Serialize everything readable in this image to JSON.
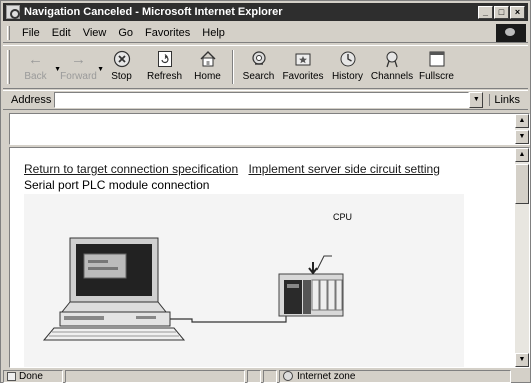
{
  "window": {
    "title": "Navigation Canceled - Microsoft Internet Explorer",
    "controls": [
      "minimize",
      "maximize",
      "close"
    ]
  },
  "menu": {
    "items": [
      {
        "label": "File"
      },
      {
        "label": "Edit"
      },
      {
        "label": "View"
      },
      {
        "label": "Go"
      },
      {
        "label": "Favorites"
      },
      {
        "label": "Help"
      }
    ]
  },
  "toolbar": {
    "back": {
      "label": "Back",
      "icon": "back-arrow-icon",
      "enabled": false
    },
    "forward": {
      "label": "Forward",
      "icon": "forward-arrow-icon",
      "enabled": false
    },
    "stop": {
      "label": "Stop",
      "icon": "stop-icon"
    },
    "refresh": {
      "label": "Refresh",
      "icon": "refresh-icon"
    },
    "home": {
      "label": "Home",
      "icon": "home-icon"
    },
    "search": {
      "label": "Search",
      "icon": "search-icon"
    },
    "favorites": {
      "label": "Favorites",
      "icon": "favorites-icon"
    },
    "history": {
      "label": "History",
      "icon": "history-icon"
    },
    "channels": {
      "label": "Channels",
      "icon": "channels-icon"
    },
    "fullscreen": {
      "label": "Fullscre",
      "icon": "fullscreen-icon"
    }
  },
  "address": {
    "label": "Address",
    "value": "",
    "links_label": "Links"
  },
  "content": {
    "link_return": "Return to target connection specification",
    "link_implement": "Implement server side circuit setting",
    "heading": "Serial port PLC module connection",
    "diagram": {
      "cpu_label": "CPU"
    }
  },
  "status": {
    "text": "Done",
    "zone": "Internet zone"
  }
}
